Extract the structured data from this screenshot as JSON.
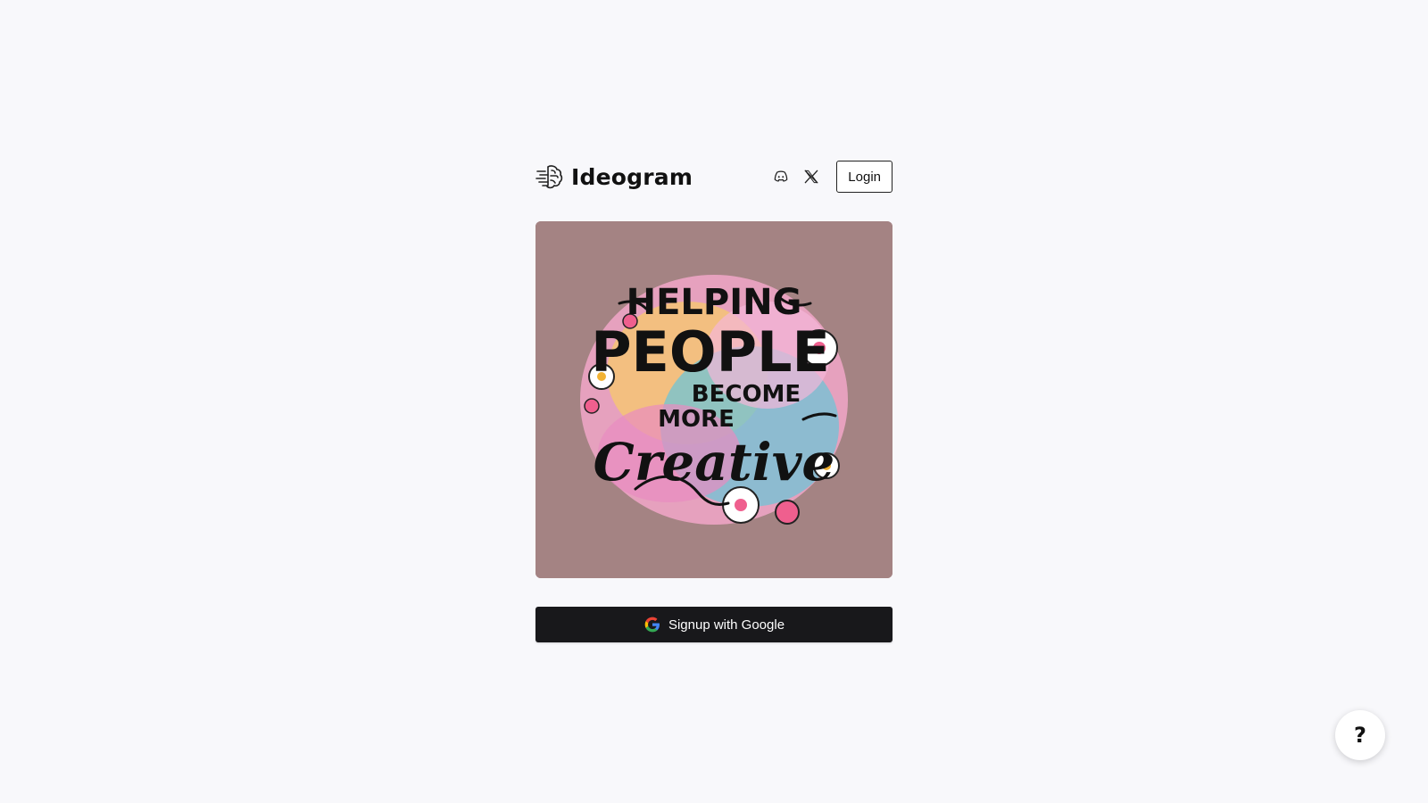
{
  "brand": {
    "name": "Ideogram",
    "logo_icon": "brain-icon"
  },
  "header": {
    "discord_icon": "discord-icon",
    "x_icon": "x-twitter-icon",
    "login_label": "Login"
  },
  "hero": {
    "image_icon": "hero-artwork",
    "artwork_lines": [
      "HELPING",
      "PEOPLE",
      "BECOME",
      "MORE",
      "Creative"
    ],
    "background_color": "#a48383"
  },
  "signup": {
    "label": "Signup with Google",
    "icon": "google-icon",
    "background_color": "#18181b"
  },
  "help": {
    "label": "?"
  }
}
